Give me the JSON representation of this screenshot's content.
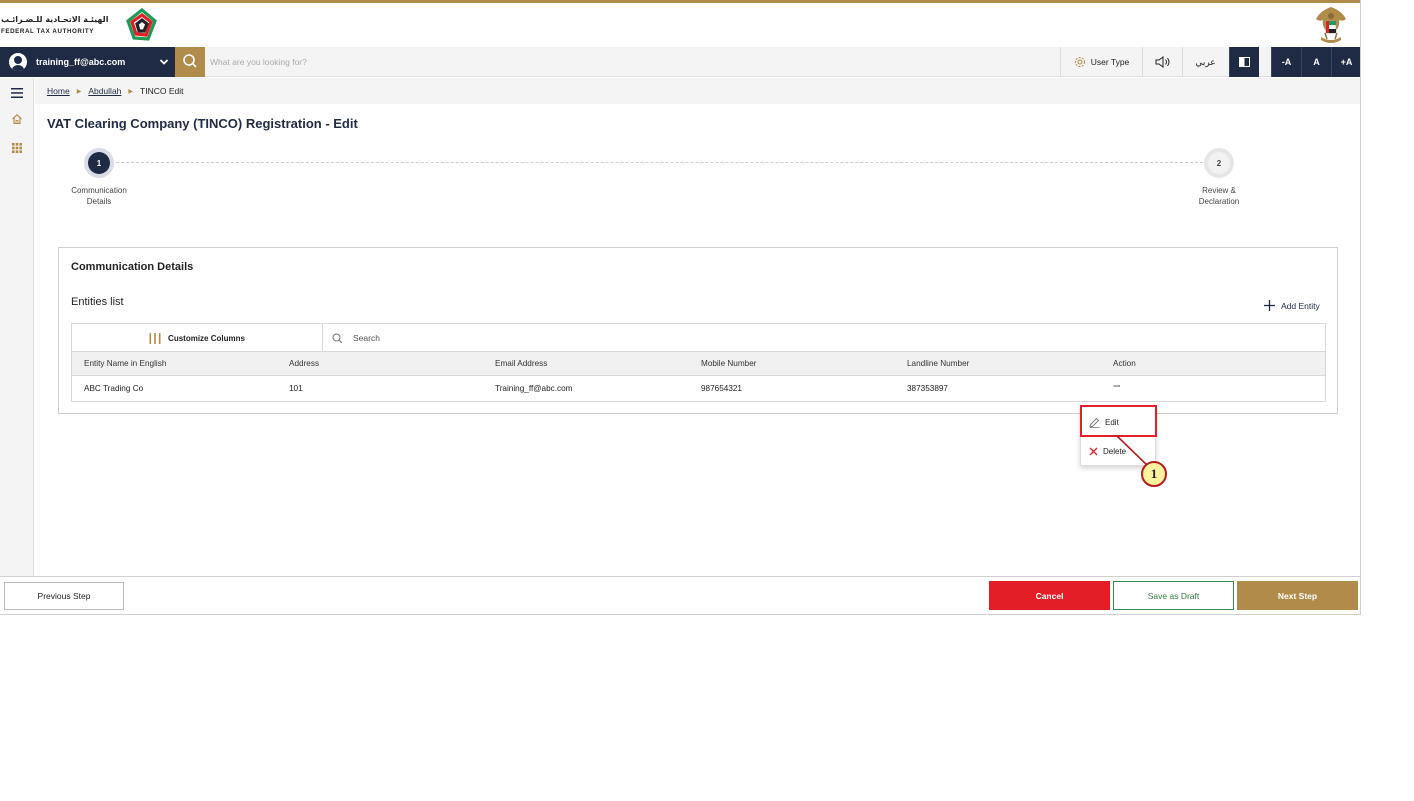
{
  "header": {
    "logo_arabic": "الهيئـة الاتحـادية للـضـرائـب",
    "logo_english": "FEDERAL TAX AUTHORITY"
  },
  "navbar": {
    "user_email": "training_ff@abc.com",
    "search_placeholder": "What are you looking for?",
    "user_type_label": "User Type",
    "language_label": "عربي",
    "font_decrease_label": "-A",
    "font_normal_label": "A",
    "font_increase_label": "+A"
  },
  "breadcrumb": {
    "items": [
      "Home",
      "Abdullah",
      "TINCO Edit"
    ]
  },
  "page": {
    "title": "VAT Clearing Company (TINCO) Registration - Edit"
  },
  "stepper": {
    "steps": [
      {
        "number": "1",
        "label_line1": "Communication",
        "label_line2": "Details",
        "state": "active"
      },
      {
        "number": "2",
        "label_line1": "Review &",
        "label_line2": "Declaration",
        "state": "pending"
      }
    ]
  },
  "card": {
    "title": "Communication Details",
    "entities_label": "Entities list",
    "add_entity_label": "Add Entity",
    "customize_columns_label": "Customize Columns",
    "search_placeholder": "Search",
    "columns": [
      "Entity Name in English",
      "Address",
      "Email Address",
      "Mobile Number",
      "Landline Number",
      "Action"
    ],
    "rows": [
      [
        "ABC Trading Co",
        "101",
        "Training_ff@abc.com",
        "987654321",
        "387353897",
        "°°°"
      ]
    ]
  },
  "action_menu": {
    "edit_label": "Edit",
    "delete_label": "Delete"
  },
  "callout": {
    "number": "1"
  },
  "footer": {
    "previous_label": "Previous Step",
    "cancel_label": "Cancel",
    "draft_label": "Save as Draft",
    "next_label": "Next Step"
  },
  "colors": {
    "navy": "#1f2a44",
    "gold": "#b18b4a",
    "cancel_red": "#e31e26",
    "draft_green": "#2f7d3f",
    "highlight_red": "#e0202a"
  },
  "icons": {
    "logo": "fta-logo-icon",
    "emblem": "uae-emblem-icon",
    "search": "search-icon",
    "user_type": "gear-icon",
    "sound": "speaker-icon",
    "contrast": "contrast-icon",
    "menu": "hamburger-icon",
    "home": "home-icon",
    "apps": "grid-icon",
    "add": "plus-icon",
    "customize": "columns-icon",
    "edit": "pencil-icon",
    "delete": "close-icon"
  }
}
